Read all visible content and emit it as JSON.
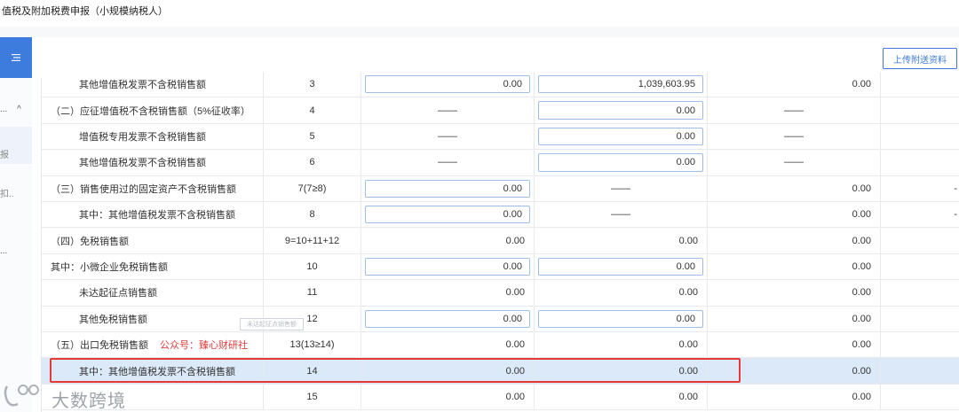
{
  "window": {
    "title": "值税及附加税费申报（小规模纳税人）"
  },
  "sidebar": {
    "menu_icon": "menu-icon",
    "items": [
      {
        "label": "...",
        "icon": "chevron-up-icon"
      },
      {
        "label": "报"
      },
      {
        "label": "扣.."
      },
      {
        "label": "..."
      }
    ]
  },
  "toolbar": {
    "upload_label": "上传附送资料"
  },
  "table": {
    "rows": [
      {
        "name": "其他增值税发票不含税销售额",
        "indent": true,
        "line": "3",
        "c3": "0.00",
        "c3_input": true,
        "c4": "1,039,603.95",
        "c4_input": true,
        "c5": "0.00",
        "c6": ""
      },
      {
        "name": "（二）应征增值税不含税销售额（5%征收率）",
        "indent": false,
        "line": "4",
        "c3": "——",
        "c4": "0.00",
        "c4_input": true,
        "c5": "——",
        "c6": ""
      },
      {
        "name": "增值税专用发票不含税销售额",
        "indent": true,
        "line": "5",
        "c3": "——",
        "c4": "0.00",
        "c4_input": true,
        "c5": "——",
        "c6": ""
      },
      {
        "name": "其他增值税发票不含税销售额",
        "indent": true,
        "line": "6",
        "c3": "——",
        "c4": "0.00",
        "c4_input": true,
        "c5": "——",
        "c6": ""
      },
      {
        "name": "（三）销售使用过的固定资产不含税销售额",
        "indent": false,
        "line": "7(7≥8)",
        "c3": "0.00",
        "c3_input": true,
        "c4": "——",
        "c5": "0.00",
        "c6": "-"
      },
      {
        "name": "其中：其他增值税发票不含税销售额",
        "indent": true,
        "line": "8",
        "c3": "0.00",
        "c3_input": true,
        "c4": "——",
        "c5": "0.00",
        "c6": "-"
      },
      {
        "name": "（四）免税销售额",
        "indent": false,
        "line": "9=10+11+12",
        "c3": "0.00",
        "c4": "0.00",
        "c5": "0.00",
        "c6": ""
      },
      {
        "name": "其中：小微企业免税销售额",
        "indent": false,
        "line": "10",
        "c3": "0.00",
        "c3_input": true,
        "c4": "0.00",
        "c4_input": true,
        "c5": "0.00",
        "c6": ""
      },
      {
        "name": "未达起征点销售额",
        "indent": true,
        "line": "11",
        "c3": "0.00",
        "c4": "0.00",
        "c5": "0.00",
        "c6": ""
      },
      {
        "name": "其他免税销售额",
        "indent": true,
        "line": "12",
        "c3": "0.00",
        "c3_input": true,
        "c4": "0.00",
        "c4_input": true,
        "c5": "0.00",
        "c6": ""
      },
      {
        "name": "（五）出口免税销售额",
        "indent": false,
        "line": "13(13≥14)",
        "c3": "0.00",
        "c4": "0.00",
        "c5": "0.00",
        "c6": ""
      },
      {
        "name": "其中：其他增值税发票不含税销售额",
        "indent": true,
        "line": "14",
        "c3": "0.00",
        "c4": "0.00",
        "c5": "0.00",
        "c6": "",
        "selected": true
      },
      {
        "name": "",
        "indent": true,
        "line": "15",
        "c3": "0.00",
        "c4": "0.00",
        "c5": "0.00",
        "c6": ""
      }
    ]
  },
  "overlay": {
    "tooltip": "未达起征点销售额",
    "note": "公众号：臻心财研社",
    "watermark": "大数跨境"
  },
  "colors": {
    "accent": "#3d7bdc",
    "highlight_row": "#dbe9f8",
    "annotation_red": "#e53935"
  }
}
